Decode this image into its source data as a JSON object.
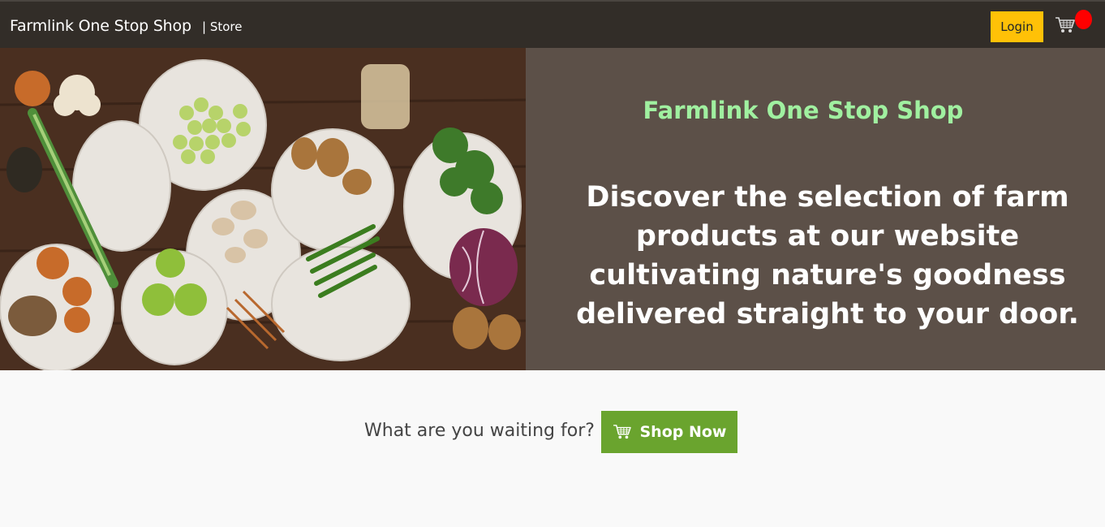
{
  "navbar": {
    "brand": "Farmlink One Stop Shop",
    "store_link": "| Store",
    "login_label": "Login",
    "cart_icon": "shopping-cart-icon",
    "badge_color": "#ff0000"
  },
  "hero": {
    "image_alt": "Fresh farm vegetables in mesh produce bags on a wooden table",
    "title": "Farmlink One Stop Shop",
    "text": "Discover the selection of farm products at our website cultivating nature's goodness delivered straight to your door.",
    "title_color": "#a0f0a0",
    "panel_color": "#5c5048"
  },
  "cta": {
    "text": "What are you waiting for?",
    "button_label": "Shop Now",
    "button_icon": "shopping-cart-icon",
    "button_color": "#6aa42e"
  },
  "colors": {
    "navbar": "#322d28",
    "login": "#ffc107",
    "page_bg": "#f9f9f9"
  }
}
